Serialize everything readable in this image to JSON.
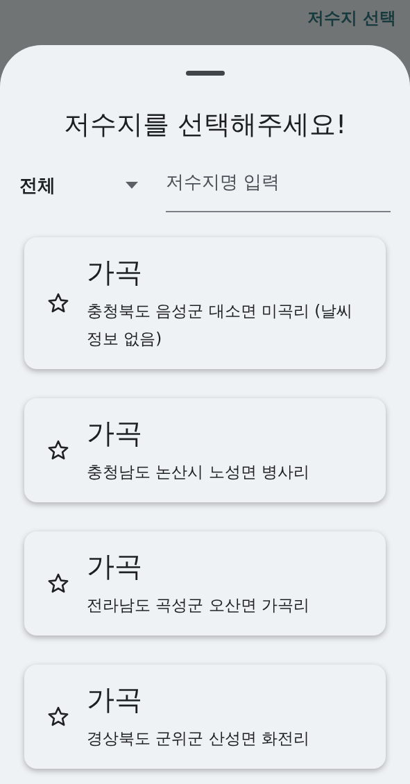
{
  "app_bar": {
    "title": "저수지 선택"
  },
  "sheet": {
    "title": "저수지를 선택해주세요!",
    "region_select": {
      "value": "전체"
    },
    "search": {
      "placeholder": "저수지명 입력"
    },
    "reservoirs": [
      {
        "name": "가곡",
        "address": "충청북도 음성군 대소면 미곡리 (날씨정보 없음)",
        "favorite": false
      },
      {
        "name": "가곡",
        "address": "충청남도 논산시 노성면 병사리",
        "favorite": false
      },
      {
        "name": "가곡",
        "address": "전라남도 곡성군 오산면 가곡리",
        "favorite": false
      },
      {
        "name": "가곡",
        "address": "경상북도 군위군 산성면 화전리",
        "favorite": false
      }
    ]
  }
}
